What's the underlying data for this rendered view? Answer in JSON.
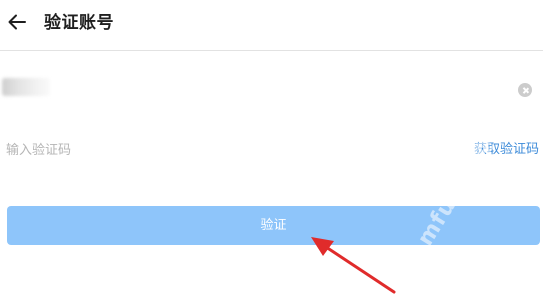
{
  "header": {
    "title": "验证账号",
    "back_icon": "arrow-left-icon"
  },
  "account": {
    "value_redacted": true,
    "clear_icon": "clear-circle-icon"
  },
  "verification": {
    "placeholder": "输入验证码",
    "get_code_label": "获取验证码"
  },
  "submit": {
    "label": "验证"
  },
  "watermark": {
    "text": "mfun 魔趣网"
  },
  "colors": {
    "accent": "#3d8bd9",
    "button": "#8ec5fa",
    "annotation_arrow": "#e02b2b"
  }
}
